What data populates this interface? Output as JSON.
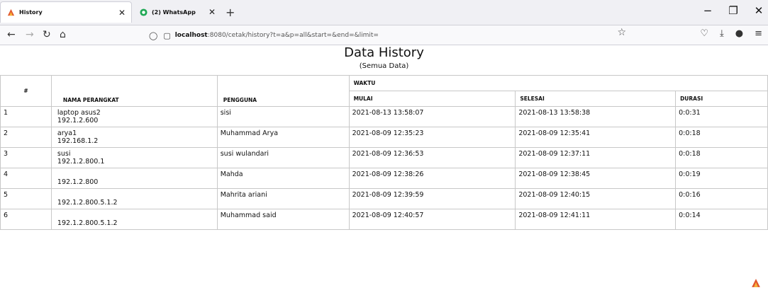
{
  "browser": {
    "tabs": [
      {
        "title": "History",
        "icon": "flame-icon",
        "active": true
      },
      {
        "title": "(2) WhatsApp",
        "icon": "whatsapp-icon",
        "active": false
      }
    ],
    "new_tab": "+",
    "url_host": "localhost",
    "url_rest": ":8080/cetak/history?t=a&p=all&start=&end=&limit="
  },
  "page": {
    "title": "Data History",
    "subtitle": "(Semua Data)"
  },
  "table": {
    "headers": {
      "no": "#",
      "device": "NAMA PERANGKAT",
      "user": "PENGGUNA",
      "group": "WAKTU",
      "start": "MULAI",
      "end": "SELESAI",
      "duration": "DURASI"
    },
    "rows": [
      {
        "no": "1",
        "device": "laptop asus2",
        "ip": "192.1.2.600",
        "user": "sisi",
        "start": "2021-08-13 13:58:07",
        "end": "2021-08-13 13:58:38",
        "duration": "0:0:31"
      },
      {
        "no": "2",
        "device": "arya1",
        "ip": "192.168.1.2",
        "user": "Muhammad Arya",
        "start": "2021-08-09 12:35:23",
        "end": "2021-08-09 12:35:41",
        "duration": "0:0:18"
      },
      {
        "no": "3",
        "device": "susi",
        "ip": "192.1.2.800.1",
        "user": "susi wulandari",
        "start": "2021-08-09 12:36:53",
        "end": "2021-08-09 12:37:11",
        "duration": "0:0:18"
      },
      {
        "no": "4",
        "device": "",
        "ip": "192.1.2.800",
        "user": "Mahda",
        "start": "2021-08-09 12:38:26",
        "end": "2021-08-09 12:38:45",
        "duration": "0:0:19"
      },
      {
        "no": "5",
        "device": "",
        "ip": "192.1.2.800.5.1.2",
        "user": "Mahrita ariani",
        "start": "2021-08-09 12:39:59",
        "end": "2021-08-09 12:40:15",
        "duration": "0:0:16"
      },
      {
        "no": "6",
        "device": "",
        "ip": "192.1.2.800.5.1.2",
        "user": "Muhammad said",
        "start": "2021-08-09 12:40:57",
        "end": "2021-08-09 12:41:11",
        "duration": "0:0:14"
      }
    ]
  }
}
